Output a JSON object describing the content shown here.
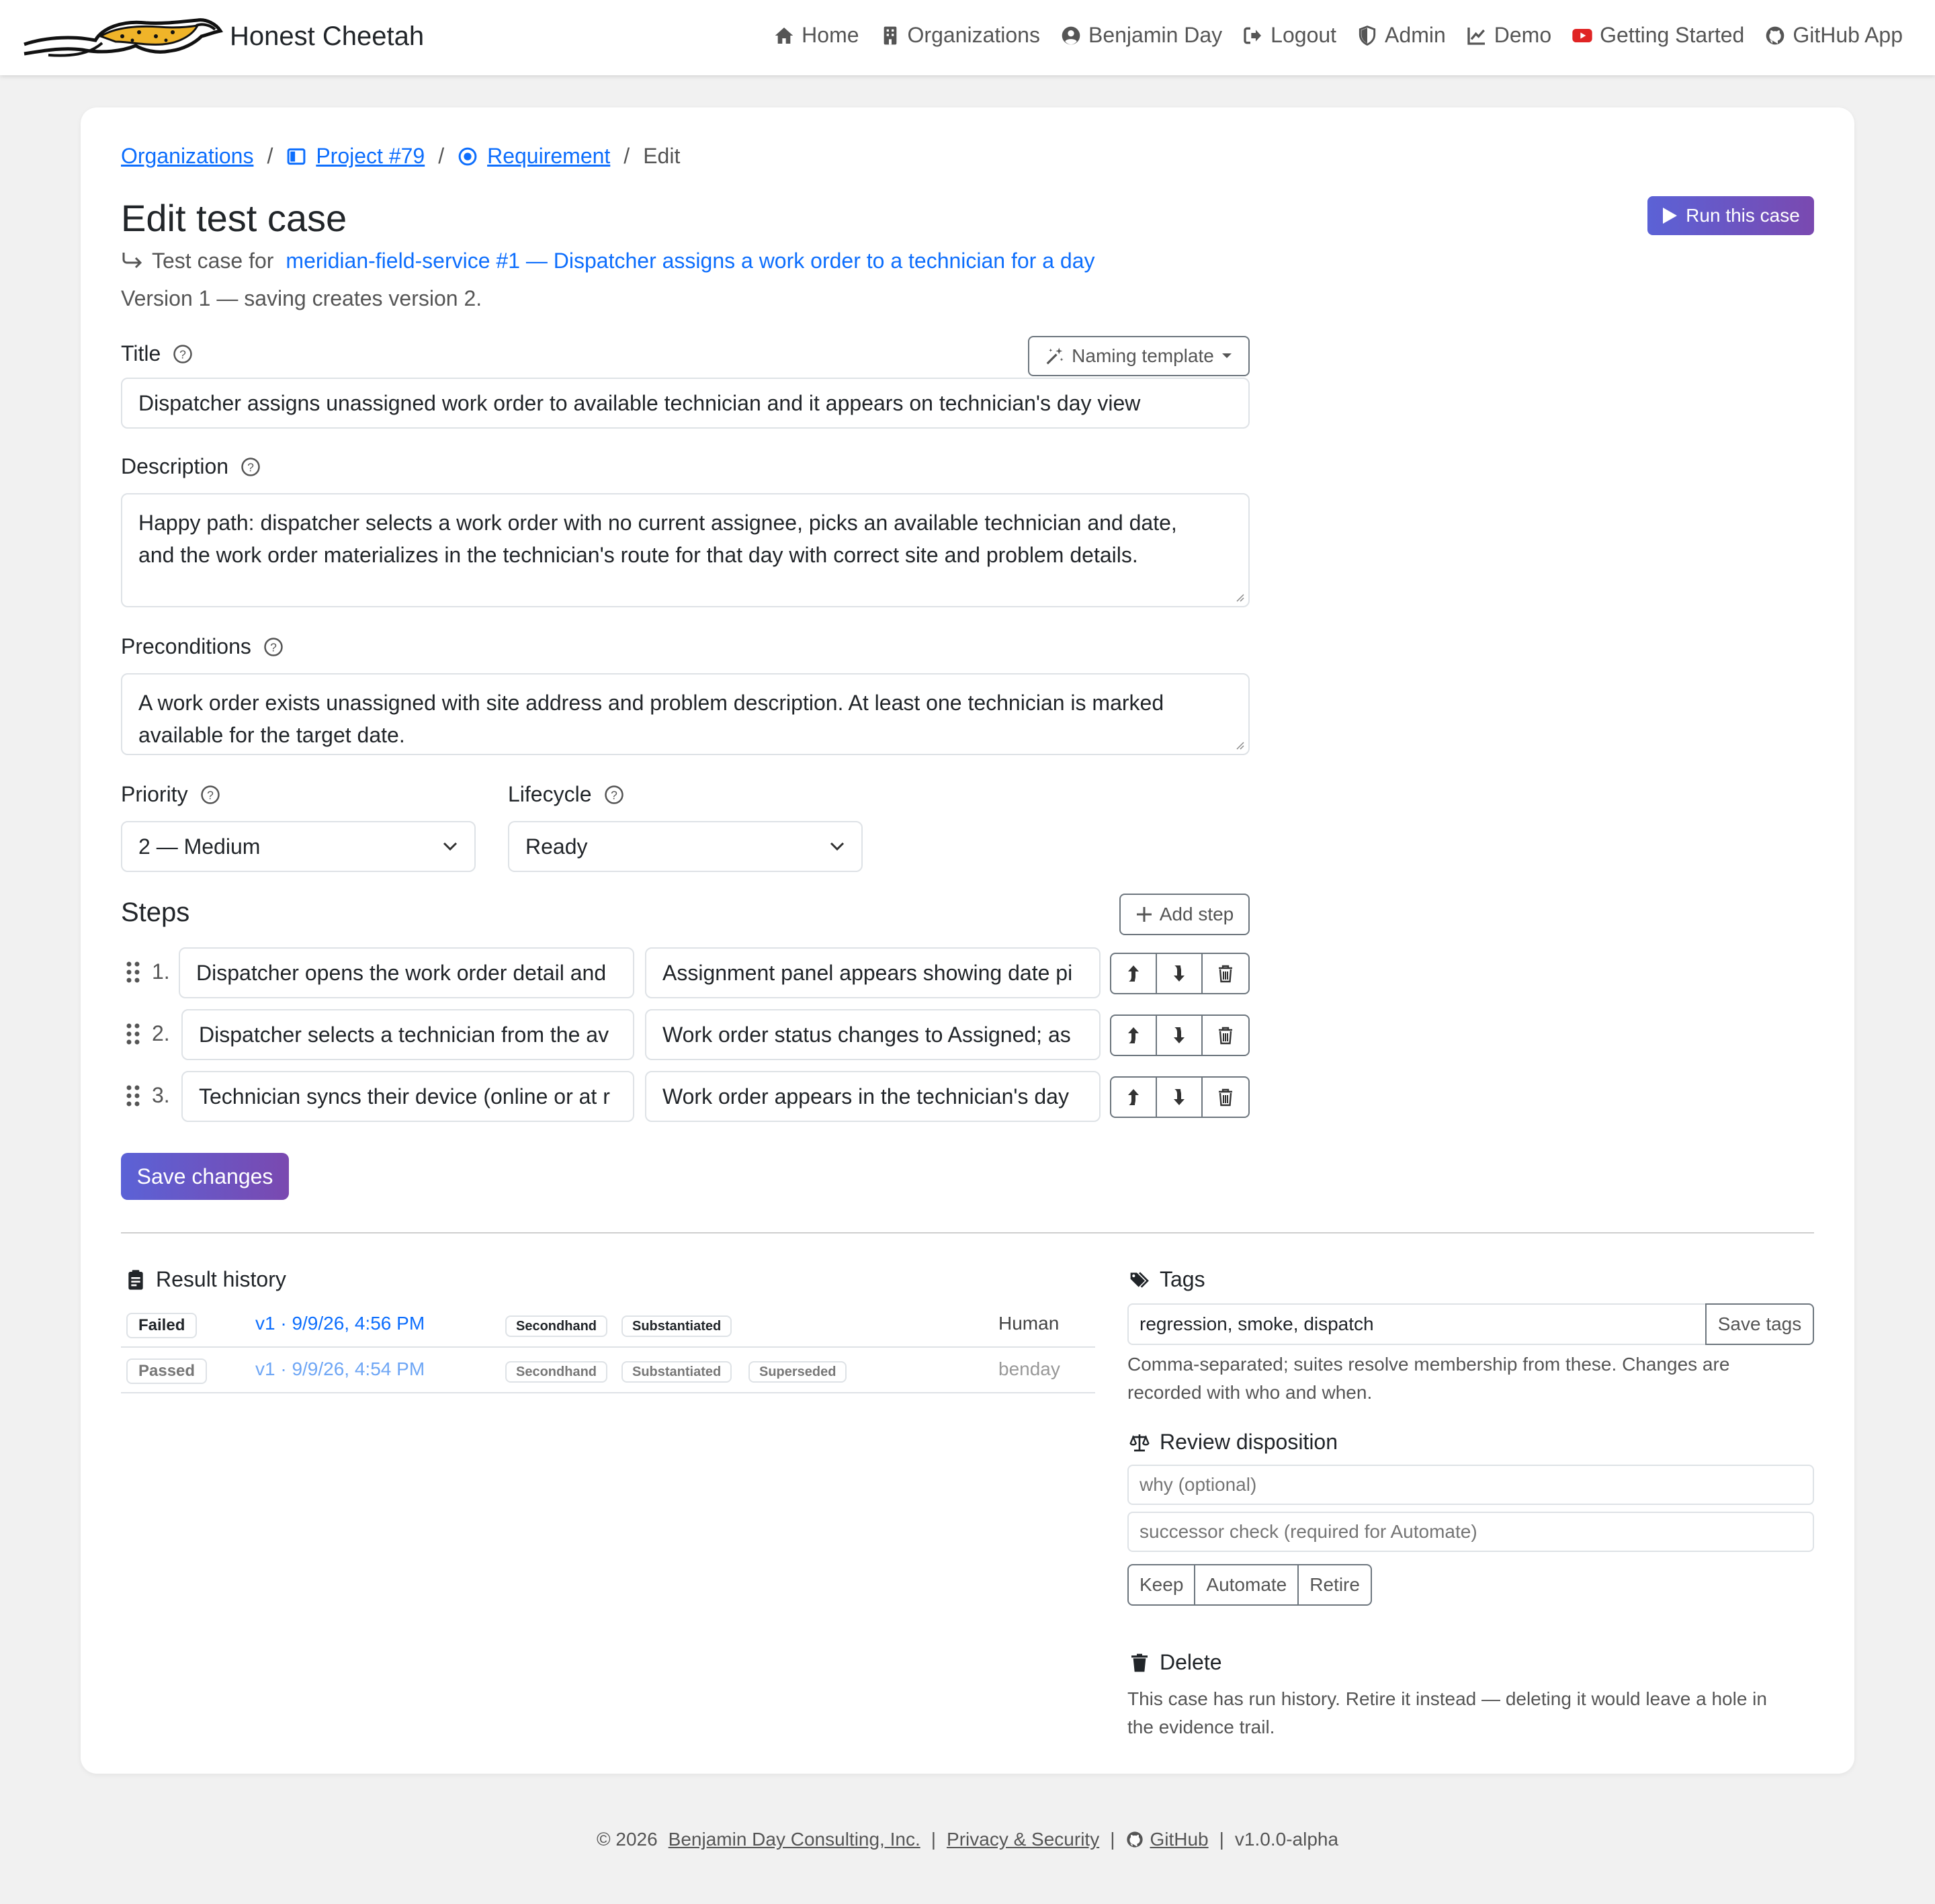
{
  "brand": {
    "name": "Honest Cheetah"
  },
  "nav": [
    {
      "label": "Home",
      "icon": "home-icon"
    },
    {
      "label": "Organizations",
      "icon": "building-icon"
    },
    {
      "label": "Benjamin Day",
      "icon": "user-circle-icon"
    },
    {
      "label": "Logout",
      "icon": "logout-icon"
    },
    {
      "label": "Admin",
      "icon": "shield-icon"
    },
    {
      "label": "Demo",
      "icon": "chart-line-icon"
    },
    {
      "label": "Getting Started",
      "icon": "youtube-icon"
    },
    {
      "label": "GitHub App",
      "icon": "github-icon"
    }
  ],
  "breadcrumb": {
    "organizations": "Organizations",
    "project": "Project #79",
    "requirement": "Requirement",
    "current": "Edit",
    "separator": "/"
  },
  "page": {
    "title": "Edit test case",
    "run_button": "Run this case",
    "test_case_for_prefix": "Test case for",
    "test_case_for_link": "meridian-field-service #1 — Dispatcher assigns a work order to a technician for a day",
    "version_note": "Version 1 — saving creates version 2."
  },
  "form": {
    "title_label": "Title",
    "naming_template": "Naming template",
    "title_value": "Dispatcher assigns unassigned work order to available technician and it appears on technician's day view",
    "description_label": "Description",
    "description_line1": "Happy path: dispatcher selects a work order with no current assignee, picks an available technician and date,",
    "description_line2": "and the work order materializes in the technician's route for that day with correct site and problem details.",
    "preconditions_label": "Preconditions",
    "preconditions_line1": "A work order exists unassigned with site address and problem description. At least one technician is marked",
    "preconditions_line2": "available for the target date.",
    "priority_label": "Priority",
    "priority_value": "2 — Medium",
    "lifecycle_label": "Lifecycle",
    "lifecycle_value": "Ready"
  },
  "steps": {
    "heading": "Steps",
    "add_step": "Add step",
    "items": [
      {
        "num": "1.",
        "action": "Dispatcher opens the work order detail and",
        "expected": "Assignment panel appears showing date pi"
      },
      {
        "num": "2.",
        "action": "Dispatcher selects a technician from the av",
        "expected": "Work order status changes to Assigned; as"
      },
      {
        "num": "3.",
        "action": "Technician syncs their device (online or at r",
        "expected": "Work order appears in the technician's day"
      }
    ]
  },
  "save_button": "Save changes",
  "results": {
    "heading": "Result history",
    "rows": [
      {
        "status": "Failed",
        "link": "v1 · 9/9/26, 4:56 PM",
        "tags": [
          "Secondhand",
          "Substantiated"
        ],
        "who": "Human"
      },
      {
        "status": "Passed",
        "link": "v1 · 9/9/26, 4:54 PM",
        "tags": [
          "Secondhand",
          "Substantiated",
          "Superseded"
        ],
        "who": "benday"
      }
    ]
  },
  "tags": {
    "heading": "Tags",
    "value": "regression, smoke, dispatch",
    "save": "Save tags",
    "help_line1": "Comma-separated; suites resolve membership from these. Changes are",
    "help_line2": "recorded with who and when."
  },
  "review": {
    "heading": "Review disposition",
    "why_placeholder": "why (optional)",
    "successor_placeholder": "successor check (required for Automate)",
    "keep": "Keep",
    "automate": "Automate",
    "retire": "Retire"
  },
  "delete": {
    "heading": "Delete",
    "line1": "This case has run history. Retire it instead — deleting it would leave a hole in",
    "line2": "the evidence trail."
  },
  "footer": {
    "copyright": "© 2026",
    "company": "Benjamin Day Consulting, Inc.",
    "privacy": "Privacy & Security",
    "github": "GitHub",
    "version": "v1.0.0-alpha",
    "separator": "|"
  }
}
